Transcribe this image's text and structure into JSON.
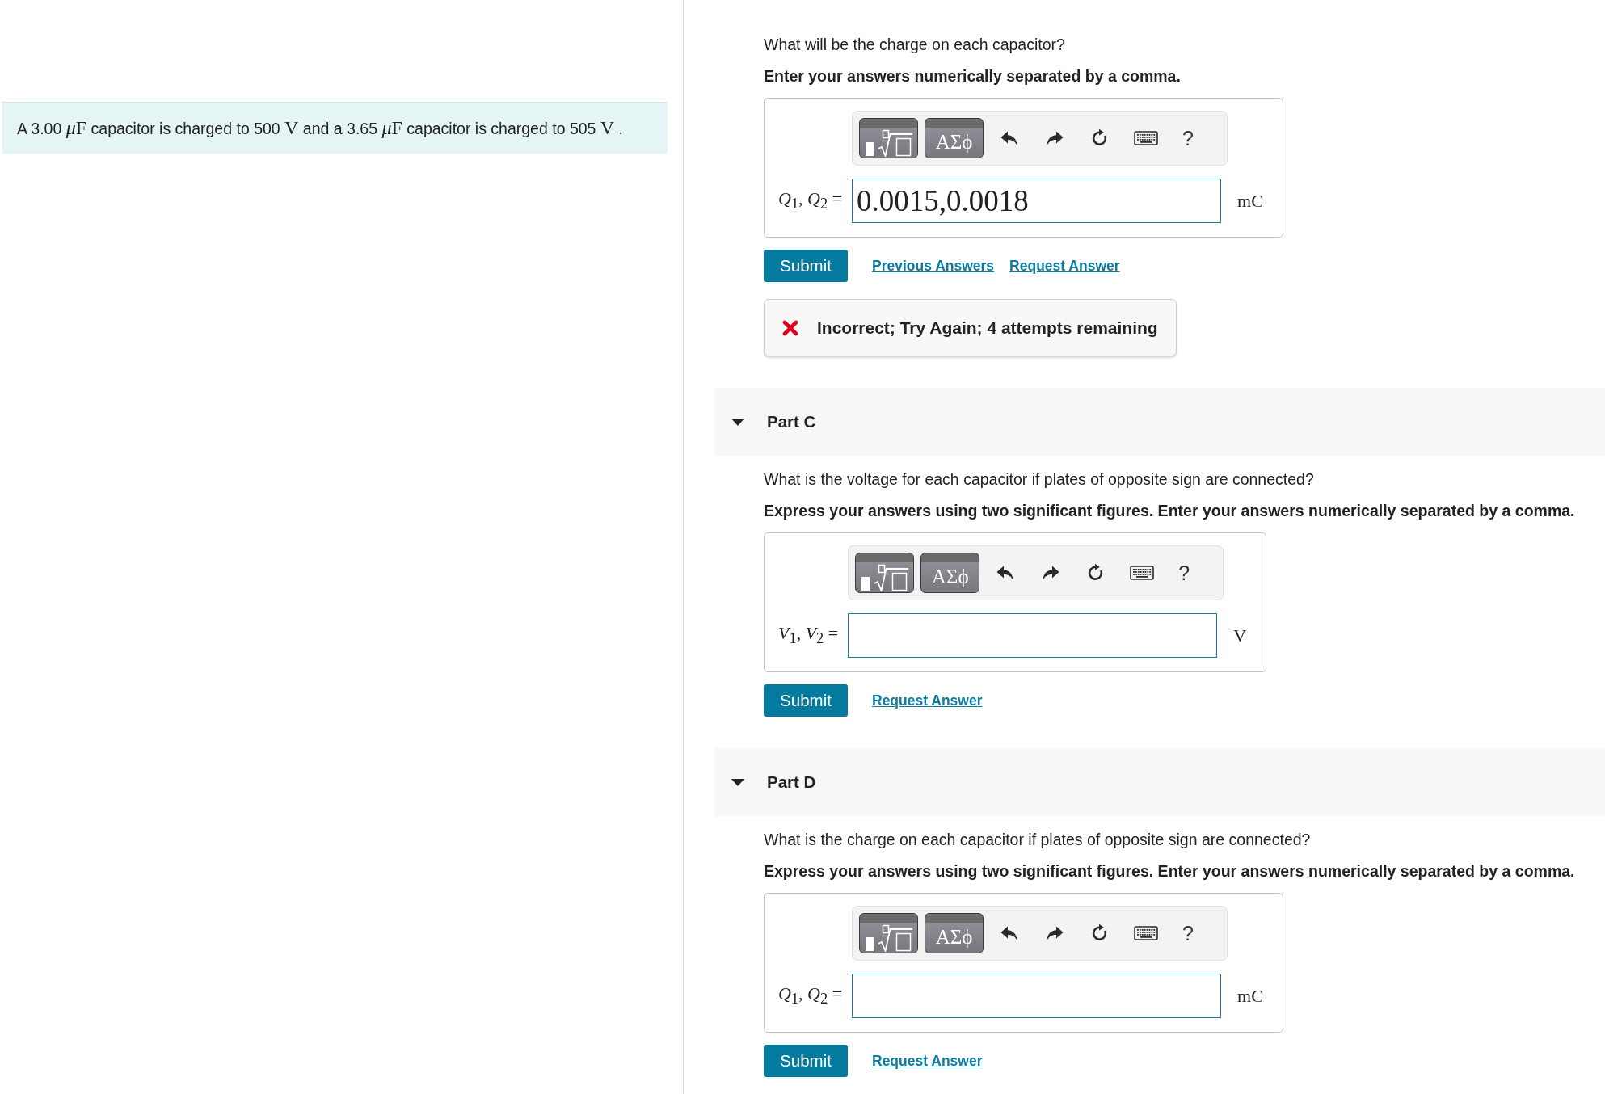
{
  "problem": {
    "statement": [
      {
        "kind": "text",
        "text": "A 3.00 "
      },
      {
        "kind": "variable",
        "text": "μ"
      },
      {
        "kind": "math",
        "text": "F"
      },
      {
        "kind": "text",
        "text": " capacitor is charged to 500 "
      },
      {
        "kind": "math",
        "text": "V"
      },
      {
        "kind": "text",
        "text": " and a 3.65 "
      },
      {
        "kind": "variable",
        "text": "μ"
      },
      {
        "kind": "math",
        "text": "F"
      },
      {
        "kind": "text",
        "text": " capacitor is charged to 505 "
      },
      {
        "kind": "math",
        "text": "V"
      },
      {
        "kind": "text",
        "text": " ."
      }
    ]
  },
  "parts": [
    {
      "question": "What will be the charge on each capacitor?",
      "instruction": "Enter your answers numerically separated by a comma.",
      "toolbar": {
        "symbols": "ΑΣϕ",
        "help": "?"
      },
      "answer": {
        "label": "*Q*$_{1}$, *Q*$_{2}$ =",
        "value": "0.0015,0.0018",
        "unit": "mC"
      },
      "submit": "Submit",
      "links": [
        "Previous Answers",
        "Request Answer"
      ],
      "feedback": {
        "kind": "incorrect",
        "text": "Incorrect; Try Again; 4 attempts remaining"
      }
    },
    {
      "title": "Part C",
      "expanded": true,
      "question": "What is the voltage for each capacitor if plates of opposite sign are connected?",
      "instruction": "Express your answers using two significant figures. Enter your answers numerically separated by a comma.",
      "toolbar": {
        "symbols": "ΑΣϕ",
        "help": "?"
      },
      "answer": {
        "label": "*V*$_{1}$, *V*$_{2}$ =",
        "unit": "V"
      },
      "submit": "Submit",
      "links": [
        "Request Answer"
      ]
    },
    {
      "title": "Part D",
      "expanded": true,
      "question": "What is the charge on each capacitor if plates of opposite sign are connected?",
      "instruction": "Express your answers using two significant figures. Enter your answers numerically separated by a comma.",
      "toolbar": {
        "symbols": "ΑΣϕ",
        "help": "?"
      },
      "answer": {
        "label": "*Q*$_{1}$, *Q*$_{2}$ =",
        "unit": "mC"
      },
      "submit": "Submit",
      "links": [
        "Request Answer"
      ]
    }
  ]
}
